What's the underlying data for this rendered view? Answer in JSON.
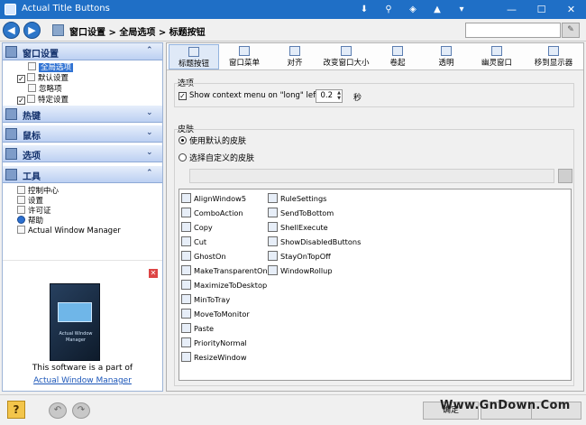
{
  "window": {
    "title": "Actual Title Buttons"
  },
  "addressbar": {
    "path": "窗口设置 > 全局选项 > 标题按钮",
    "search_placeholder": ""
  },
  "sidebar": {
    "panels": [
      {
        "label": "窗口设置"
      },
      {
        "label": "热键"
      },
      {
        "label": "鼠标"
      },
      {
        "label": "选项"
      },
      {
        "label": "工具"
      }
    ],
    "window_items": [
      "全局选项",
      "默认设置",
      "忽略项",
      "特定设置"
    ],
    "tool_items": [
      "控制中心",
      "设置",
      "许可证",
      "帮助",
      "Actual Window Manager"
    ],
    "promo_text": "This software is a part of",
    "promo_link": "Actual Window Manager",
    "box_art_text": "Actual Window Manager"
  },
  "tabs": [
    "标题按钮",
    "窗口菜单",
    "对齐",
    "改变窗口大小",
    "卷起",
    "透明",
    "幽灵窗口",
    "移到显示器"
  ],
  "options": {
    "group_title": "选项",
    "context_menu_label": "Show context menu on \"long\" left click",
    "context_menu_checked": true,
    "delay_value": "0.2",
    "delay_unit": "秒"
  },
  "skin": {
    "group_title": "皮肤",
    "use_default_label": "使用默认的皮肤",
    "use_custom_label": "选择自定义的皮肤",
    "selected": "default",
    "path_value": ""
  },
  "skin_items_col1": [
    "AlignWindow5",
    "ComboAction",
    "Copy",
    "Cut",
    "GhostOn",
    "MakeTransparentOn",
    "MaximizeToDesktop",
    "MinToTray",
    "MoveToMonitor",
    "Paste",
    "PriorityNormal",
    "ResizeWindow"
  ],
  "skin_items_col2": [
    "RuleSettings",
    "SendToBottom",
    "ShellExecute",
    "ShowDisabledButtons",
    "StayOnTopOff",
    "WindowRollup"
  ],
  "bottom": {
    "ok_label": "确定"
  },
  "watermark": "Www.GnDown.Com",
  "colors": {
    "titlebar": "#1f6fc6",
    "selection": "#3173d3",
    "link": "#1a55b8"
  }
}
